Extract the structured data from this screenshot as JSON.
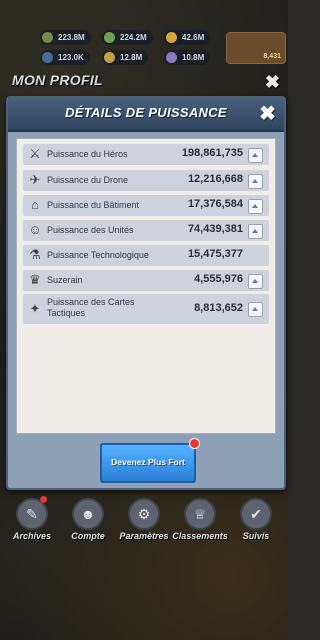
{
  "resources": [
    {
      "value": "223.8M",
      "color": "#7a8a4a"
    },
    {
      "value": "224.2M",
      "color": "#6fa04a"
    },
    {
      "value": "42.6M",
      "color": "#d9a33a"
    },
    {
      "value": "123.0K",
      "color": "#4a6a9a"
    },
    {
      "value": "12.8M",
      "color": "#c8a040"
    },
    {
      "value": "10.8M",
      "color": "#8a7ac0"
    }
  ],
  "power_badge": "8,431",
  "profile": {
    "title": "MON PROFIL",
    "close_icon": "close-icon"
  },
  "modal": {
    "title": "DÉTAILS DE PUISSANCE",
    "rows": [
      {
        "icon": "hero-icon",
        "glyph": "⚔",
        "label": "Puissance du Héros",
        "value": "198,861,735",
        "tall": false
      },
      {
        "icon": "drone-icon",
        "glyph": "✈",
        "label": "Puissance du Drone",
        "value": "12,216,668",
        "tall": false
      },
      {
        "icon": "building-icon",
        "glyph": "⌂",
        "label": "Puissance du Bâtiment",
        "value": "17,376,584",
        "tall": false
      },
      {
        "icon": "units-icon",
        "glyph": "☺",
        "label": "Puissance des Unités",
        "value": "74,439,381",
        "tall": false
      },
      {
        "icon": "flask-icon",
        "glyph": "⚗",
        "label": "Puissance Technologique",
        "value": "15,475,377",
        "tall": false
      },
      {
        "icon": "suzerain-icon",
        "glyph": "♛",
        "label": "Suzerain",
        "value": "4,555,976",
        "tall": false
      },
      {
        "icon": "cards-icon",
        "glyph": "✦",
        "label": "Puissance des Cartes Tactiques",
        "value": "8,813,652",
        "tall": true
      }
    ],
    "cta_label": "Devenez Plus Fort"
  },
  "nav": [
    {
      "name": "archives",
      "label": "Archives",
      "glyph": "✎",
      "badge": true
    },
    {
      "name": "compte",
      "label": "Compte",
      "glyph": "☻",
      "badge": false
    },
    {
      "name": "parametres",
      "label": "Paramètres",
      "glyph": "⚙",
      "badge": false
    },
    {
      "name": "classements",
      "label": "Classements",
      "glyph": "♕",
      "badge": false
    },
    {
      "name": "suivis",
      "label": "Suivis",
      "glyph": "✔",
      "badge": false
    }
  ]
}
